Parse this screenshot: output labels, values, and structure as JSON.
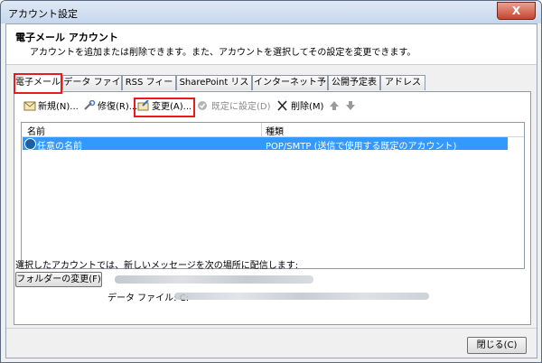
{
  "window": {
    "title": "アカウント設定",
    "close_glyph": "X"
  },
  "header": {
    "title": "電子メール アカウント",
    "description": "アカウントを追加または削除できます。また、アカウントを選択してその設定を変更できます。"
  },
  "tabs": [
    {
      "label": "電子メール"
    },
    {
      "label": "データ ファイル"
    },
    {
      "label": "RSS フィード"
    },
    {
      "label": "SharePoint リスト"
    },
    {
      "label": "インターネット予定表"
    },
    {
      "label": "公開予定表"
    },
    {
      "label": "アドレス帳"
    }
  ],
  "toolbar": {
    "new_label": "新規(N)...",
    "repair_label": "修復(R)...",
    "change_label": "変更(A)...",
    "default_label": "既定に設定(D)",
    "delete_label": "削除(M)"
  },
  "accounts_list": {
    "columns": [
      "名前",
      "種類"
    ],
    "rows": [
      {
        "name": "任意の名前",
        "type": "POP/SMTP (送信で使用する既定のアカウント)"
      }
    ]
  },
  "delivery": {
    "label": "選択したアカウントでは、新しいメッセージを次の場所に配信します:",
    "change_folder_button": "フォルダーの変更(F)",
    "data_file_label": "データ ファイル: C:"
  },
  "footer": {
    "close_button": "閉じる(C)"
  },
  "colors": {
    "highlight": "#e81c1c",
    "selection": "#3399ff"
  }
}
